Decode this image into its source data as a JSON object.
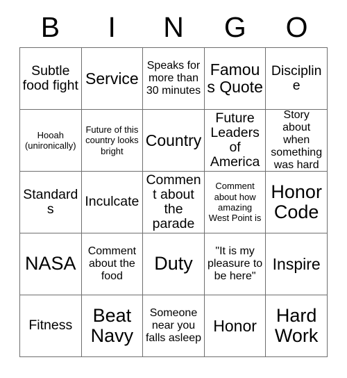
{
  "card": {
    "columns": [
      "B",
      "I",
      "N",
      "G",
      "O"
    ],
    "rows": [
      [
        {
          "text": "Subtle food fight",
          "size": "fs-l"
        },
        {
          "text": "Service",
          "size": "fs-xl"
        },
        {
          "text": "Speaks for more than 30 minutes",
          "size": "fs-m"
        },
        {
          "text": "Famous Quote",
          "size": "fs-xl"
        },
        {
          "text": "Discipline",
          "size": "fs-l"
        }
      ],
      [
        {
          "text": "Hooah (unironically)",
          "size": "fs-s"
        },
        {
          "text": "Future of this country looks bright",
          "size": "fs-s"
        },
        {
          "text": "Country",
          "size": "fs-xl"
        },
        {
          "text": "Future Leaders of America",
          "size": "fs-l"
        },
        {
          "text": "Story about when something was hard",
          "size": "fs-m"
        }
      ],
      [
        {
          "text": "Standards",
          "size": "fs-l"
        },
        {
          "text": "Inculcate",
          "size": "fs-l"
        },
        {
          "text": "Comment about the parade",
          "size": "fs-l"
        },
        {
          "text": "Comment about how amazing West Point is",
          "size": "fs-s"
        },
        {
          "text": "Honor Code",
          "size": "fs-xxl"
        }
      ],
      [
        {
          "text": "NASA",
          "size": "fs-xxl"
        },
        {
          "text": "Comment about the food",
          "size": "fs-m"
        },
        {
          "text": "Duty",
          "size": "fs-xxl"
        },
        {
          "text": "\"It is my pleasure to be here\"",
          "size": "fs-m"
        },
        {
          "text": "Inspire",
          "size": "fs-xl"
        }
      ],
      [
        {
          "text": "Fitness",
          "size": "fs-l"
        },
        {
          "text": "Beat Navy",
          "size": "fs-xxl"
        },
        {
          "text": "Someone near you falls asleep",
          "size": "fs-m"
        },
        {
          "text": "Honor",
          "size": "fs-xl"
        },
        {
          "text": "Hard Work",
          "size": "fs-xxl"
        }
      ]
    ]
  },
  "colors": {
    "background": "#ffffff",
    "text": "#000000",
    "grid_line": "#6e6e6e"
  }
}
